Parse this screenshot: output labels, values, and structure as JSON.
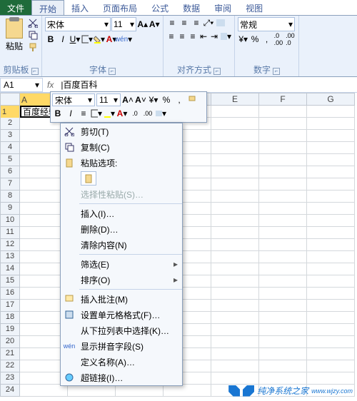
{
  "tabs": {
    "file": "文件",
    "items": [
      "开始",
      "插入",
      "页面布局",
      "公式",
      "数据",
      "审阅",
      "视图"
    ],
    "active": 0
  },
  "ribbon": {
    "clipboard": {
      "paste": "粘贴",
      "label": "剪贴板"
    },
    "font": {
      "name": "宋体",
      "size": "11",
      "label": "字体"
    },
    "align": {
      "label": "对齐方式"
    },
    "number": {
      "format": "常规",
      "label": "数字"
    }
  },
  "formula_bar": {
    "name": "A1",
    "value": "百度经验|百度百科"
  },
  "grid": {
    "cols": [
      "A",
      "B",
      "C",
      "D",
      "E",
      "F",
      "G"
    ],
    "rows": 24,
    "a1": "百度经验",
    "b1": "百度百科",
    "float_label": "|百度百科"
  },
  "mini": {
    "font": "宋体",
    "size": "11"
  },
  "context_menu": [
    {
      "icon": "cut",
      "label": "剪切(T)",
      "type": "item"
    },
    {
      "icon": "copy",
      "label": "复制(C)",
      "type": "item"
    },
    {
      "icon": "paste",
      "label": "粘贴选项:",
      "type": "header"
    },
    {
      "icon": "paste-opt",
      "label": "",
      "type": "pasteopt"
    },
    {
      "icon": "",
      "label": "选择性粘贴(S)…",
      "type": "disabled"
    },
    {
      "type": "sep"
    },
    {
      "icon": "",
      "label": "插入(I)…",
      "type": "item"
    },
    {
      "icon": "",
      "label": "删除(D)…",
      "type": "item"
    },
    {
      "icon": "",
      "label": "清除内容(N)",
      "type": "item"
    },
    {
      "type": "sep"
    },
    {
      "icon": "",
      "label": "筛选(E)",
      "type": "sub"
    },
    {
      "icon": "",
      "label": "排序(O)",
      "type": "sub"
    },
    {
      "type": "sep"
    },
    {
      "icon": "comment",
      "label": "插入批注(M)",
      "type": "item"
    },
    {
      "icon": "format",
      "label": "设置单元格格式(F)…",
      "type": "item"
    },
    {
      "icon": "",
      "label": "从下拉列表中选择(K)…",
      "type": "item"
    },
    {
      "icon": "wen",
      "label": "显示拼音字段(S)",
      "type": "item"
    },
    {
      "icon": "",
      "label": "定义名称(A)…",
      "type": "item"
    },
    {
      "icon": "link",
      "label": "超链接(I)…",
      "type": "item"
    }
  ],
  "watermark": "纯净系统之家"
}
